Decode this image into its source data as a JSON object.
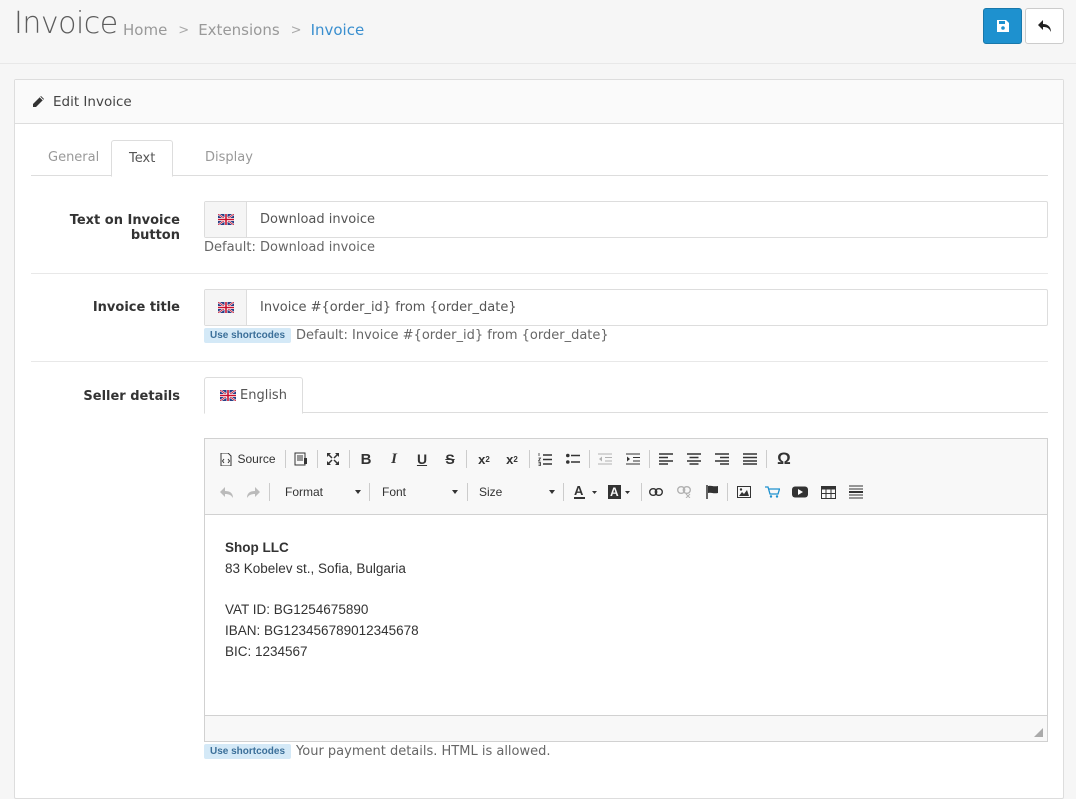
{
  "header": {
    "title": "Invoice",
    "breadcrumbs": [
      "Home",
      "Extensions",
      "Invoice"
    ],
    "save_icon": "floppy-disk-icon",
    "back_icon": "reply-arrow-icon"
  },
  "panel": {
    "heading": "Edit Invoice",
    "heading_icon": "pencil-icon"
  },
  "tabs": [
    "General",
    "Text",
    "Display"
  ],
  "active_tab": "Text",
  "fields": {
    "button_text": {
      "label": "Text on Invoice button",
      "value": "Download invoice",
      "help": "Default: Download invoice"
    },
    "invoice_title": {
      "label": "Invoice title",
      "value": "Invoice #{order_id} from {order_date}",
      "badge": "Use shortcodes",
      "help": "Default: Invoice #{order_id} from {order_date}"
    },
    "seller_details": {
      "label": "Seller details",
      "lang_tab": "English",
      "badge": "Use shortcodes",
      "help": "Your payment details. HTML is allowed.",
      "content": [
        "Shop LLC",
        "83 Kobelev st., Sofia, Bulgaria",
        "",
        "VAT ID: BG1254675890",
        "IBAN: BG123456789012345678",
        "BIC: 1234567"
      ]
    }
  },
  "editor": {
    "source_label": "Source",
    "format_label": "Format",
    "font_label": "Font",
    "size_label": "Size"
  },
  "colors": {
    "primary": "#1e91cf",
    "link": "#3a8fcf",
    "badge_bg": "#d4e9f7"
  }
}
